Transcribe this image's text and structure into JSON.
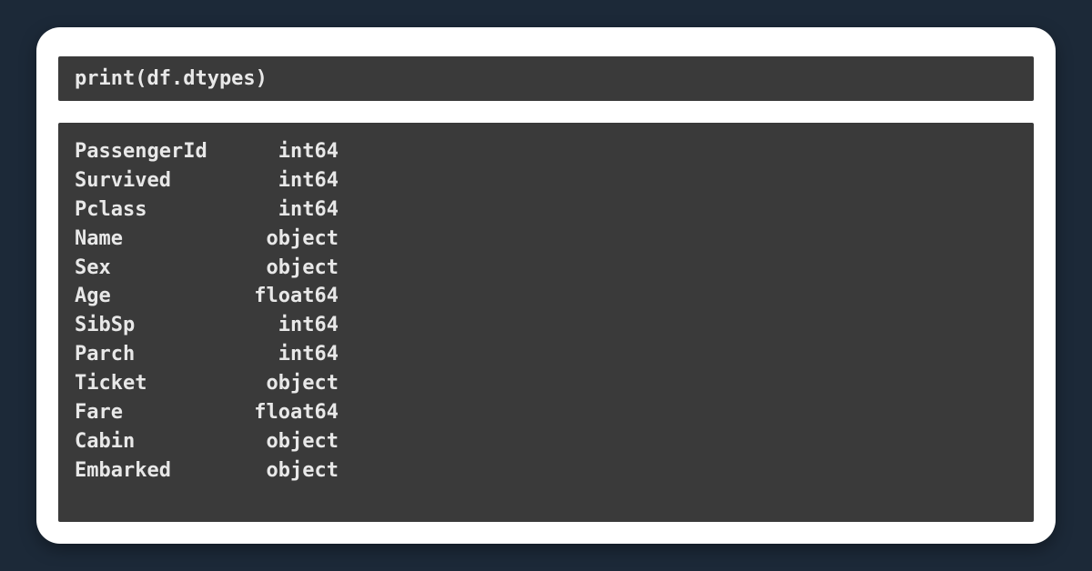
{
  "code": "print(df.dtypes)",
  "output": {
    "rows": [
      {
        "name": "PassengerId",
        "dtype": "int64"
      },
      {
        "name": "Survived",
        "dtype": "int64"
      },
      {
        "name": "Pclass",
        "dtype": "int64"
      },
      {
        "name": "Name",
        "dtype": "object"
      },
      {
        "name": "Sex",
        "dtype": "object"
      },
      {
        "name": "Age",
        "dtype": "float64"
      },
      {
        "name": "SibSp",
        "dtype": "int64"
      },
      {
        "name": "Parch",
        "dtype": "int64"
      },
      {
        "name": "Ticket",
        "dtype": "object"
      },
      {
        "name": "Fare",
        "dtype": "float64"
      },
      {
        "name": "Cabin",
        "dtype": "object"
      },
      {
        "name": "Embarked",
        "dtype": "object"
      }
    ]
  }
}
